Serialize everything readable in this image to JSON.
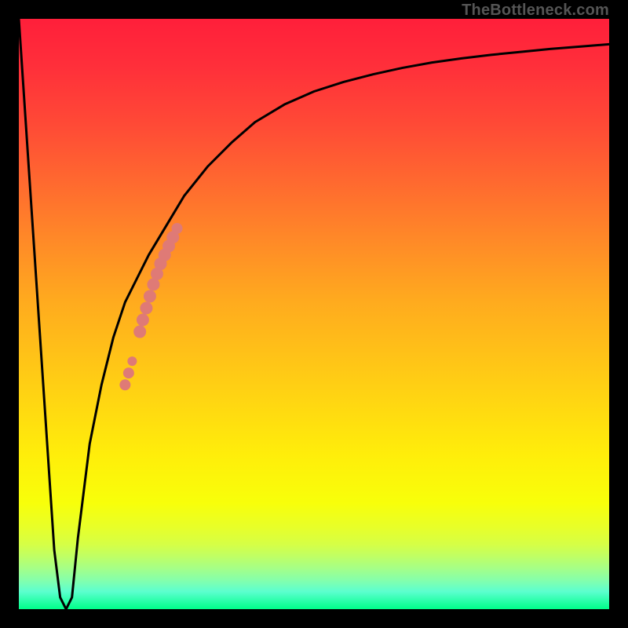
{
  "watermark": "TheBottleneck.com",
  "colors": {
    "frame": "#000000",
    "curve_stroke": "#000000",
    "marker_fill": "#df7a76",
    "watermark": "#555555"
  },
  "chart_data": {
    "type": "line",
    "title": "",
    "xlabel": "",
    "ylabel": "",
    "xlim": [
      0,
      100
    ],
    "ylim": [
      0,
      100
    ],
    "series": [
      {
        "name": "bottleneck-curve",
        "x": [
          0,
          2,
          4,
          6,
          7,
          8,
          9,
          10,
          12,
          14,
          16,
          18,
          20,
          22,
          25,
          28,
          32,
          36,
          40,
          45,
          50,
          55,
          60,
          65,
          70,
          75,
          80,
          85,
          90,
          95,
          100
        ],
        "y": [
          100,
          70,
          40,
          10,
          2,
          0,
          2,
          12,
          28,
          38,
          46,
          52,
          56,
          60,
          65,
          70,
          75,
          79,
          82.5,
          85.5,
          87.7,
          89.3,
          90.6,
          91.7,
          92.6,
          93.3,
          93.9,
          94.4,
          94.9,
          95.3,
          95.7
        ]
      }
    ],
    "markers": [
      {
        "x": 18.0,
        "y": 38.0,
        "r": 7
      },
      {
        "x": 18.6,
        "y": 40.0,
        "r": 7
      },
      {
        "x": 19.2,
        "y": 42.0,
        "r": 6
      },
      {
        "x": 20.5,
        "y": 47.0,
        "r": 8
      },
      {
        "x": 21.0,
        "y": 49.0,
        "r": 8
      },
      {
        "x": 21.6,
        "y": 51.0,
        "r": 8
      },
      {
        "x": 22.2,
        "y": 53.0,
        "r": 8
      },
      {
        "x": 22.8,
        "y": 55.0,
        "r": 8
      },
      {
        "x": 23.4,
        "y": 56.8,
        "r": 8
      },
      {
        "x": 24.0,
        "y": 58.5,
        "r": 8
      },
      {
        "x": 24.7,
        "y": 60.0,
        "r": 8
      },
      {
        "x": 25.4,
        "y": 61.5,
        "r": 8
      },
      {
        "x": 26.1,
        "y": 63.0,
        "r": 8
      },
      {
        "x": 26.8,
        "y": 64.5,
        "r": 7
      }
    ]
  }
}
